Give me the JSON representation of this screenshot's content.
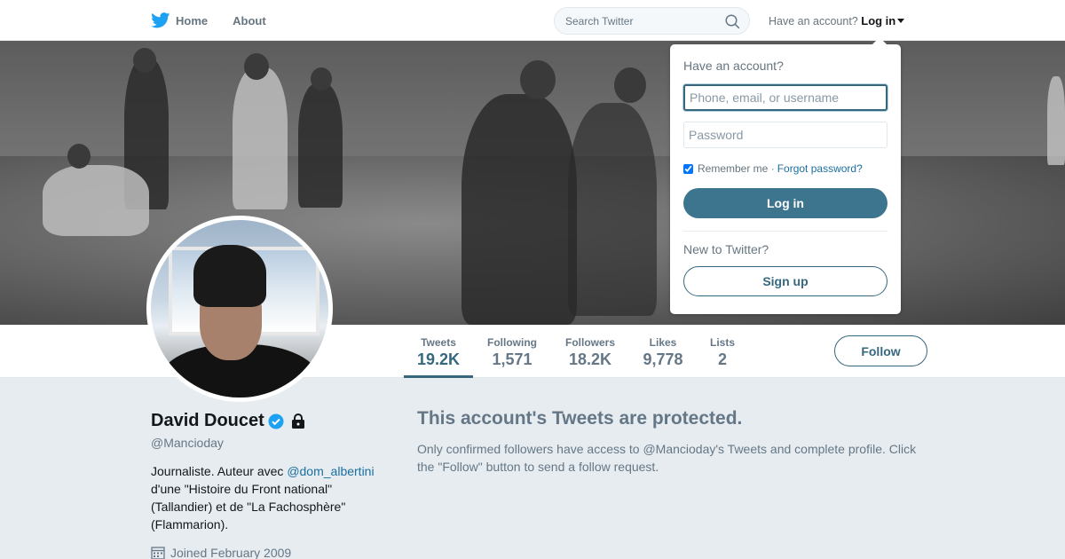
{
  "colors": {
    "accent": "#36677e",
    "link": "#1b6fa0",
    "muted": "#657786",
    "page_bg": "#e6ecf0",
    "brand_blue": "#1da1f2"
  },
  "topbar": {
    "logo_icon": "twitter-bird-icon",
    "home_label": "Home",
    "about_label": "About",
    "search_placeholder": "Search Twitter",
    "search_icon": "search-icon",
    "have_account_text": "Have an account?",
    "login_label": "Log in"
  },
  "login_dropdown": {
    "heading": "Have an account?",
    "username_placeholder": "Phone, email, or username",
    "username_value": "",
    "password_placeholder": "Password",
    "password_value": "",
    "remember_label": "Remember me",
    "remember_checked": true,
    "separator": "·",
    "forgot_label": "Forgot password?",
    "login_button": "Log in",
    "new_to_twitter": "New to Twitter?",
    "signup_button": "Sign up"
  },
  "profile_nav": {
    "stats": [
      {
        "label": "Tweets",
        "value": "19.2K",
        "active": true
      },
      {
        "label": "Following",
        "value": "1,571",
        "active": false
      },
      {
        "label": "Followers",
        "value": "18.2K",
        "active": false
      },
      {
        "label": "Likes",
        "value": "9,778",
        "active": false
      },
      {
        "label": "Lists",
        "value": "2",
        "active": false
      }
    ],
    "follow_button": "Follow"
  },
  "profile": {
    "name": "David Doucet",
    "verified_icon": "verified-badge-icon",
    "protected_icon": "lock-icon",
    "handle": "@Mancioday",
    "bio_before_link": "Journaliste. Auteur avec ",
    "bio_link": "@dom_albertini",
    "bio_after_link": " d'une \"Histoire du Front national\" (Tallandier) et de \"La Fachosphère\" (Flammarion).",
    "joined_icon": "calendar-icon",
    "joined": "Joined February 2009"
  },
  "protected": {
    "title": "This account's Tweets are protected.",
    "text": "Only confirmed followers have access to @Mancioday's Tweets and complete profile. Click the \"Follow\" button to send a follow request."
  }
}
